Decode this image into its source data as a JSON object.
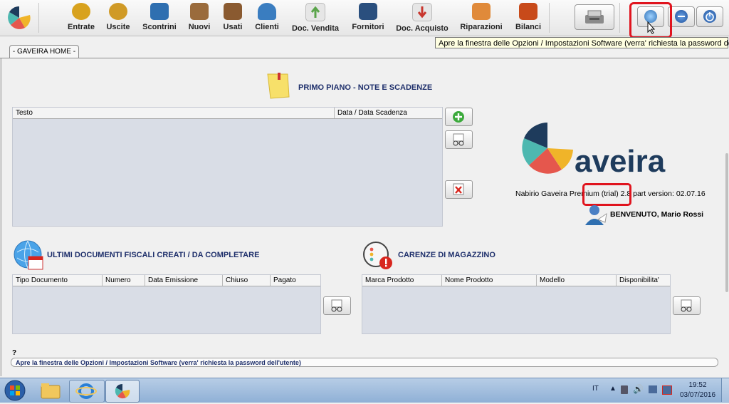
{
  "toolbar": {
    "buttons": [
      {
        "label": "Entrate",
        "color": "#d8a21e"
      },
      {
        "label": "Uscite",
        "color": "#d09a26"
      },
      {
        "label": "Scontrini",
        "color": "#2f6fb0"
      },
      {
        "label": "Nuovi",
        "color": "#9a6b3c"
      },
      {
        "label": "Usati",
        "color": "#8a5a30"
      },
      {
        "label": "Clienti",
        "color": "#3a7dc0"
      },
      {
        "label": "Doc. Vendita",
        "color": "#5aa44a"
      },
      {
        "label": "Fornitori",
        "color": "#2a4f7e"
      },
      {
        "label": "Doc. Acquisto",
        "color": "#c8362e"
      },
      {
        "label": "Riparazioni",
        "color": "#e08a3a"
      },
      {
        "label": "Bilanci",
        "color": "#c84a1a"
      }
    ]
  },
  "tooltip": "Apre la finestra delle Opzioni / Impostazioni Software (verra' richiesta la password dell'utente)",
  "tab": {
    "label": "- GAVEIRA HOME -"
  },
  "notes": {
    "title": "PRIMO PIANO  -  NOTE E SCADENZE",
    "columns": [
      "Testo",
      "Data / Data Scadenza"
    ]
  },
  "brand": {
    "logo_text": "aveira",
    "version_text": "Nabirio Gaveira Premium (trial) 2.8 part version: 02.07.16",
    "welcome": "BENVENUTO, Mario Rossi"
  },
  "documents": {
    "title": "ULTIMI DOCUMENTI FISCALI CREATI / DA COMPLETARE",
    "columns": [
      "Tipo Documento",
      "Numero",
      "Data Emissione",
      "Chiuso",
      "Pagato"
    ]
  },
  "shortages": {
    "title": "CARENZE DI MAGAZZINO",
    "columns": [
      "Marca Prodotto",
      "Nome Prodotto",
      "Modello",
      "Disponibilita'"
    ]
  },
  "status": {
    "question": "?",
    "text": "Apre la finestra delle Opzioni / Impostazioni Software (verra' richiesta la password dell'utente)"
  },
  "taskbar": {
    "lang": "IT",
    "time": "19:52",
    "date": "03/07/2016"
  },
  "colors": {
    "accent_red": "#e0141e",
    "title_blue": "#1e2f6b",
    "table_bg": "#d9dde6"
  }
}
